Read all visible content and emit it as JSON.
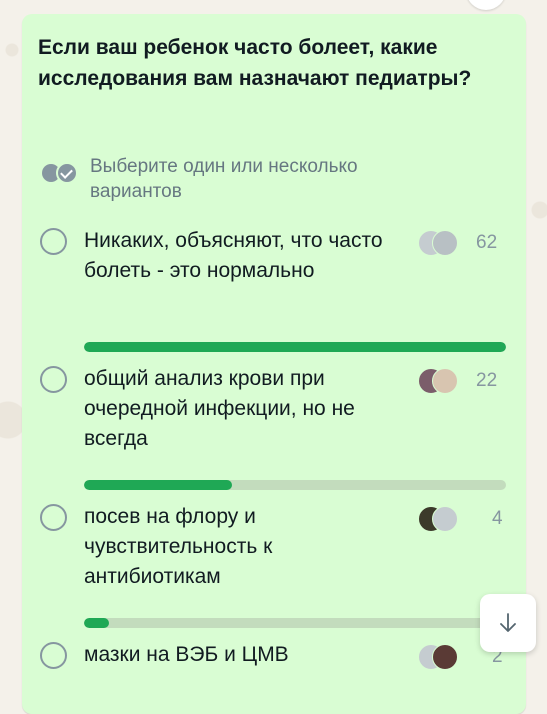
{
  "poll": {
    "question": "Если ваш ребенок часто болеет, какие исследования вам назначают педиатры?",
    "hint": "Выберите один или несколько вариантов",
    "options": [
      {
        "label": "Никаких, объясняют, что часто болеть - это нормально",
        "votes": "62",
        "share": 1.0
      },
      {
        "label": "общий анализ крови при очередной инфекции, но не всегда",
        "votes": "22",
        "share": 0.35
      },
      {
        "label": "посев на флору и чувствительность к антибиотикам",
        "votes": "4",
        "share": 0.06
      },
      {
        "label": "мазки на ВЭБ и ЦМВ",
        "votes": "2",
        "share": 0.03
      }
    ]
  },
  "colors": {
    "bubble": "#d9fdd3",
    "bar_fill": "#1fa855",
    "bar_track": "#c3dcbd",
    "muted": "#8696a0"
  },
  "icons": {
    "hint": "double-check-icon",
    "scroll": "arrow-down-icon"
  }
}
